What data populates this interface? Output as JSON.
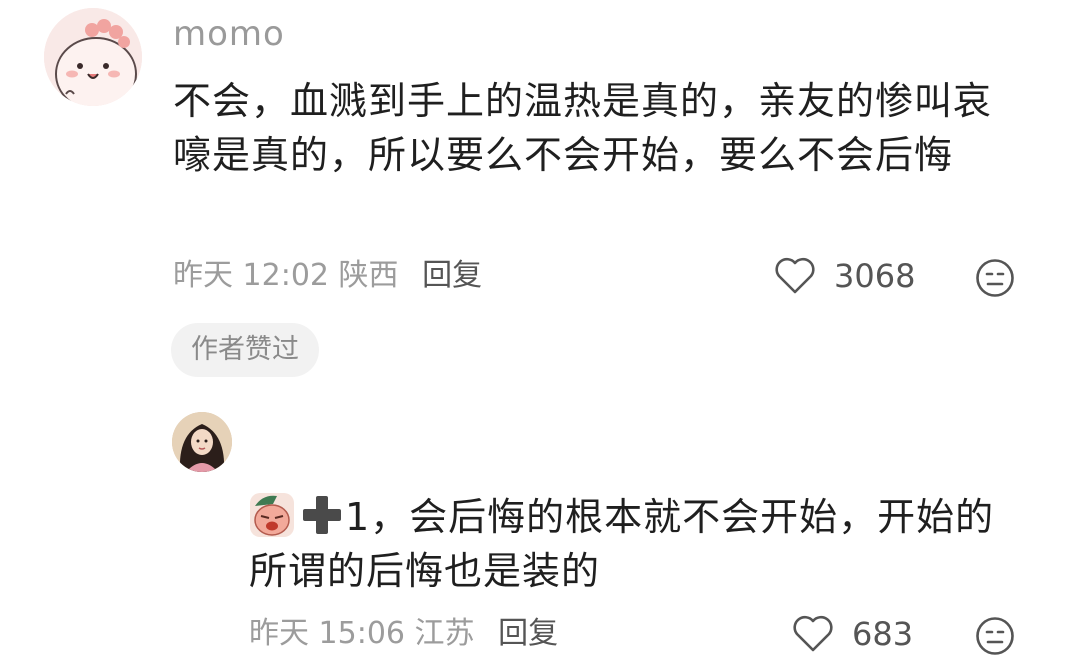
{
  "comment": {
    "username": "momo",
    "text": "不会，血溅到手上的温热是真的，亲友的惨叫哀嚎是真的，所以要么不会开始，要么不会后悔",
    "time": "昨天 12:02",
    "location": "陕西",
    "reply_label": "回复",
    "likes": "3068",
    "author_tag": "作者赞过"
  },
  "reply": {
    "text": "1，会后悔的根本就不会开始，开始的所谓的后悔也是装的",
    "time": "昨天 15:06",
    "location": "江苏",
    "reply_label": "回复",
    "likes": "683"
  },
  "icons": {
    "like": "heart-outline-icon",
    "dislike": "meh-face-icon",
    "emoji1": "crying-face-sticker",
    "emoji2": "plus-icon"
  },
  "colors": {
    "text": "#1f1f1f",
    "meta": "#9c9c9c",
    "tag_bg": "#f2f2f2"
  }
}
